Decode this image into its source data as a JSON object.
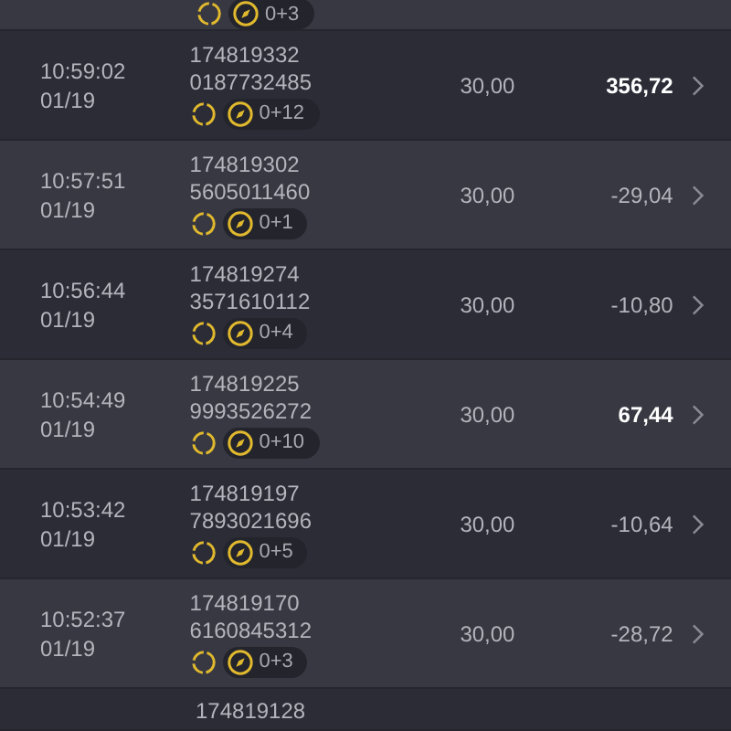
{
  "rows": [
    {
      "kind": "cut_top",
      "badge": "0+3"
    },
    {
      "kind": "full",
      "time": "10:59:02",
      "date": "01/19",
      "id_line_1": "174819332",
      "id_line_2": "0187732485",
      "badge": "0+12",
      "stake": "30,00",
      "result": "356,72",
      "positive": true
    },
    {
      "kind": "full",
      "time": "10:57:51",
      "date": "01/19",
      "id_line_1": "174819302",
      "id_line_2": "5605011460",
      "badge": "0+1",
      "stake": "30,00",
      "result": "-29,04",
      "positive": false
    },
    {
      "kind": "full",
      "time": "10:56:44",
      "date": "01/19",
      "id_line_1": "174819274",
      "id_line_2": "3571610112",
      "badge": "0+4",
      "stake": "30,00",
      "result": "-10,80",
      "positive": false
    },
    {
      "kind": "full",
      "time": "10:54:49",
      "date": "01/19",
      "id_line_1": "174819225",
      "id_line_2": "9993526272",
      "badge": "0+10",
      "stake": "30,00",
      "result": "67,44",
      "positive": true
    },
    {
      "kind": "full",
      "time": "10:53:42",
      "date": "01/19",
      "id_line_1": "174819197",
      "id_line_2": "7893021696",
      "badge": "0+5",
      "stake": "30,00",
      "result": "-10,64",
      "positive": false
    },
    {
      "kind": "full",
      "time": "10:52:37",
      "date": "01/19",
      "id_line_1": "174819170",
      "id_line_2": "6160845312",
      "badge": "0+3",
      "stake": "30,00",
      "result": "-28,72",
      "positive": false
    },
    {
      "kind": "cut_bottom",
      "id_line_1": "174819128"
    }
  ]
}
